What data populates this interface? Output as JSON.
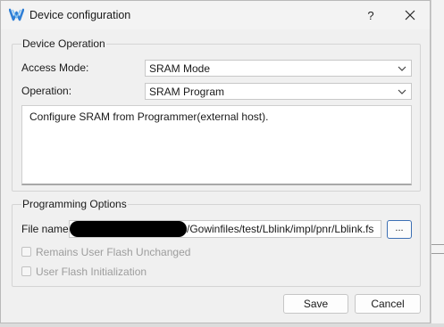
{
  "window": {
    "title": "Device configuration",
    "help_label": "?",
    "close_label": "✕",
    "icon": "gowin-logo-icon"
  },
  "device_operation": {
    "group_title": "Device Operation",
    "access_mode_label": "Access Mode:",
    "access_mode_value": "SRAM Mode",
    "operation_label": "Operation:",
    "operation_value": "SRAM Program",
    "description": "Configure SRAM from Programmer(external host)."
  },
  "programming_options": {
    "group_title": "Programming Options",
    "file_name_label": "File name:",
    "file_path_visible": "/Gowinfiles/test/Lblink/impl/pnr/Lblink.fs",
    "browse_label": "...",
    "remains_flash_label": "Remains User Flash Unchanged",
    "remains_flash_checked": false,
    "flash_init_label": "User Flash Initialization",
    "flash_init_checked": false
  },
  "footer": {
    "save_label": "Save",
    "cancel_label": "Cancel"
  },
  "colors": {
    "dialog_bg": "#f0f0f0",
    "field_bg": "#ffffff",
    "focus_border": "#3c6fb4",
    "disabled_text": "#9d9d9d",
    "logo_blue": "#2f7fd6"
  }
}
